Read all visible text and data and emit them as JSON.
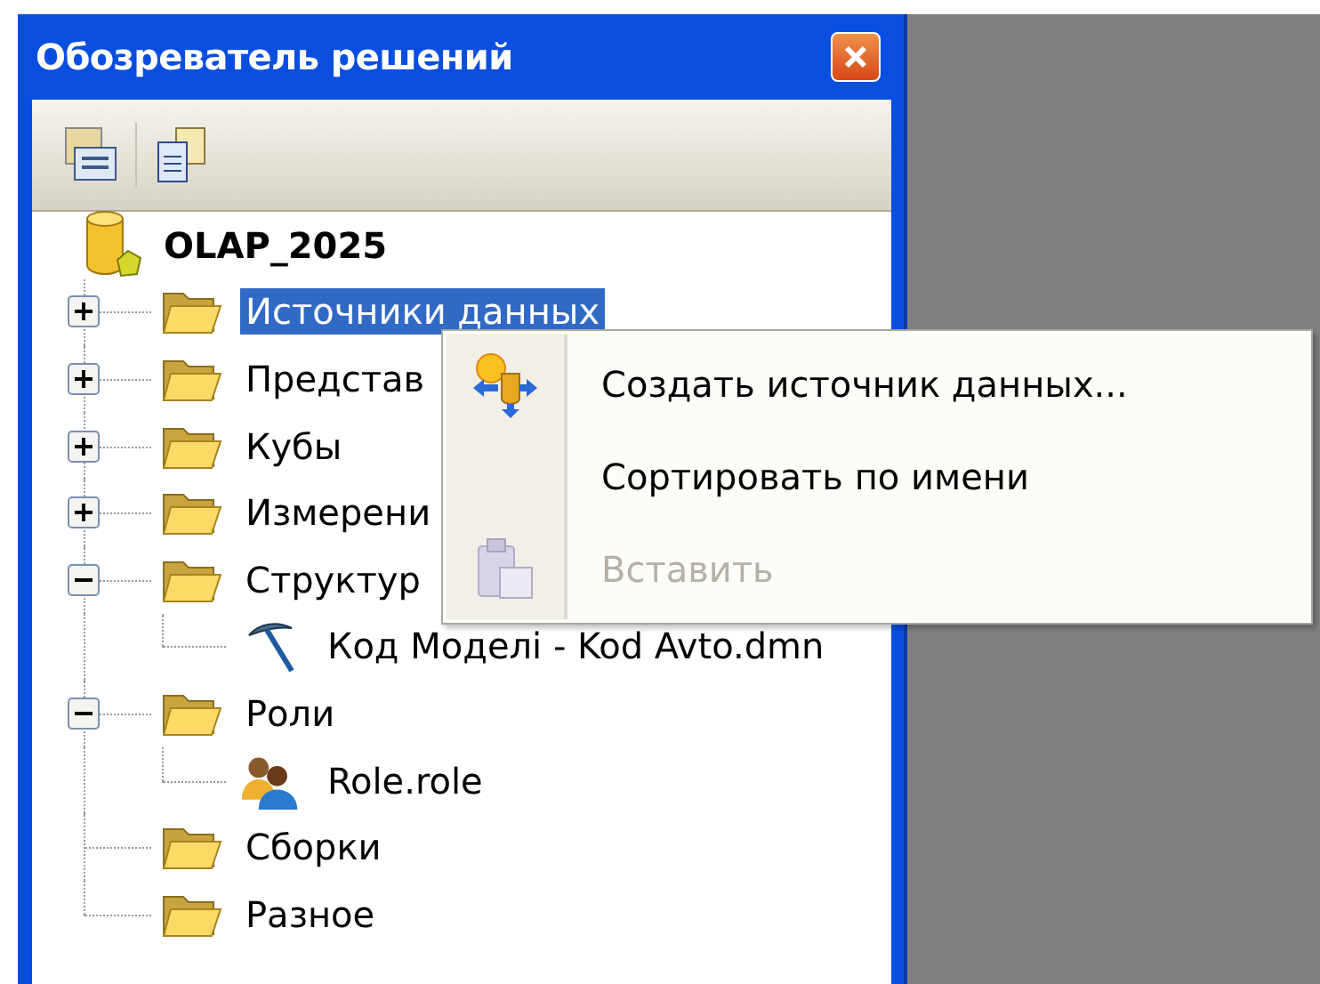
{
  "window": {
    "title": "Обозреватель решений"
  },
  "tree": {
    "root": {
      "label": "OLAP_2025",
      "kind": "database",
      "selected": false,
      "children": [
        {
          "label": "Источники данных",
          "kind": "folder",
          "selected": true,
          "expanded": false
        },
        {
          "label": "Представ",
          "kind": "folder",
          "selected": false,
          "expanded": false
        },
        {
          "label": "Кубы",
          "kind": "folder",
          "selected": false,
          "expanded": false
        },
        {
          "label": "Измерени",
          "kind": "folder",
          "selected": false,
          "expanded": false
        },
        {
          "label": "Структур",
          "kind": "folder",
          "selected": false,
          "expanded": true,
          "children": [
            {
              "label": "Код Моделі - Kod Avto.dmn",
              "kind": "mining-model",
              "selected": false
            }
          ]
        },
        {
          "label": "Роли",
          "kind": "folder",
          "selected": false,
          "expanded": true,
          "children": [
            {
              "label": "Role.role",
              "kind": "role",
              "selected": false
            }
          ]
        },
        {
          "label": "Сборки",
          "kind": "folder",
          "selected": false
        },
        {
          "label": "Разное",
          "kind": "folder",
          "selected": false
        }
      ]
    }
  },
  "context_menu": {
    "items": [
      {
        "label": "Создать источник данных...",
        "kind": "create",
        "disabled": false
      },
      {
        "label": "Сортировать по имени",
        "kind": "plain",
        "disabled": false
      },
      {
        "label": "Вставить",
        "kind": "paste",
        "disabled": true
      }
    ]
  }
}
